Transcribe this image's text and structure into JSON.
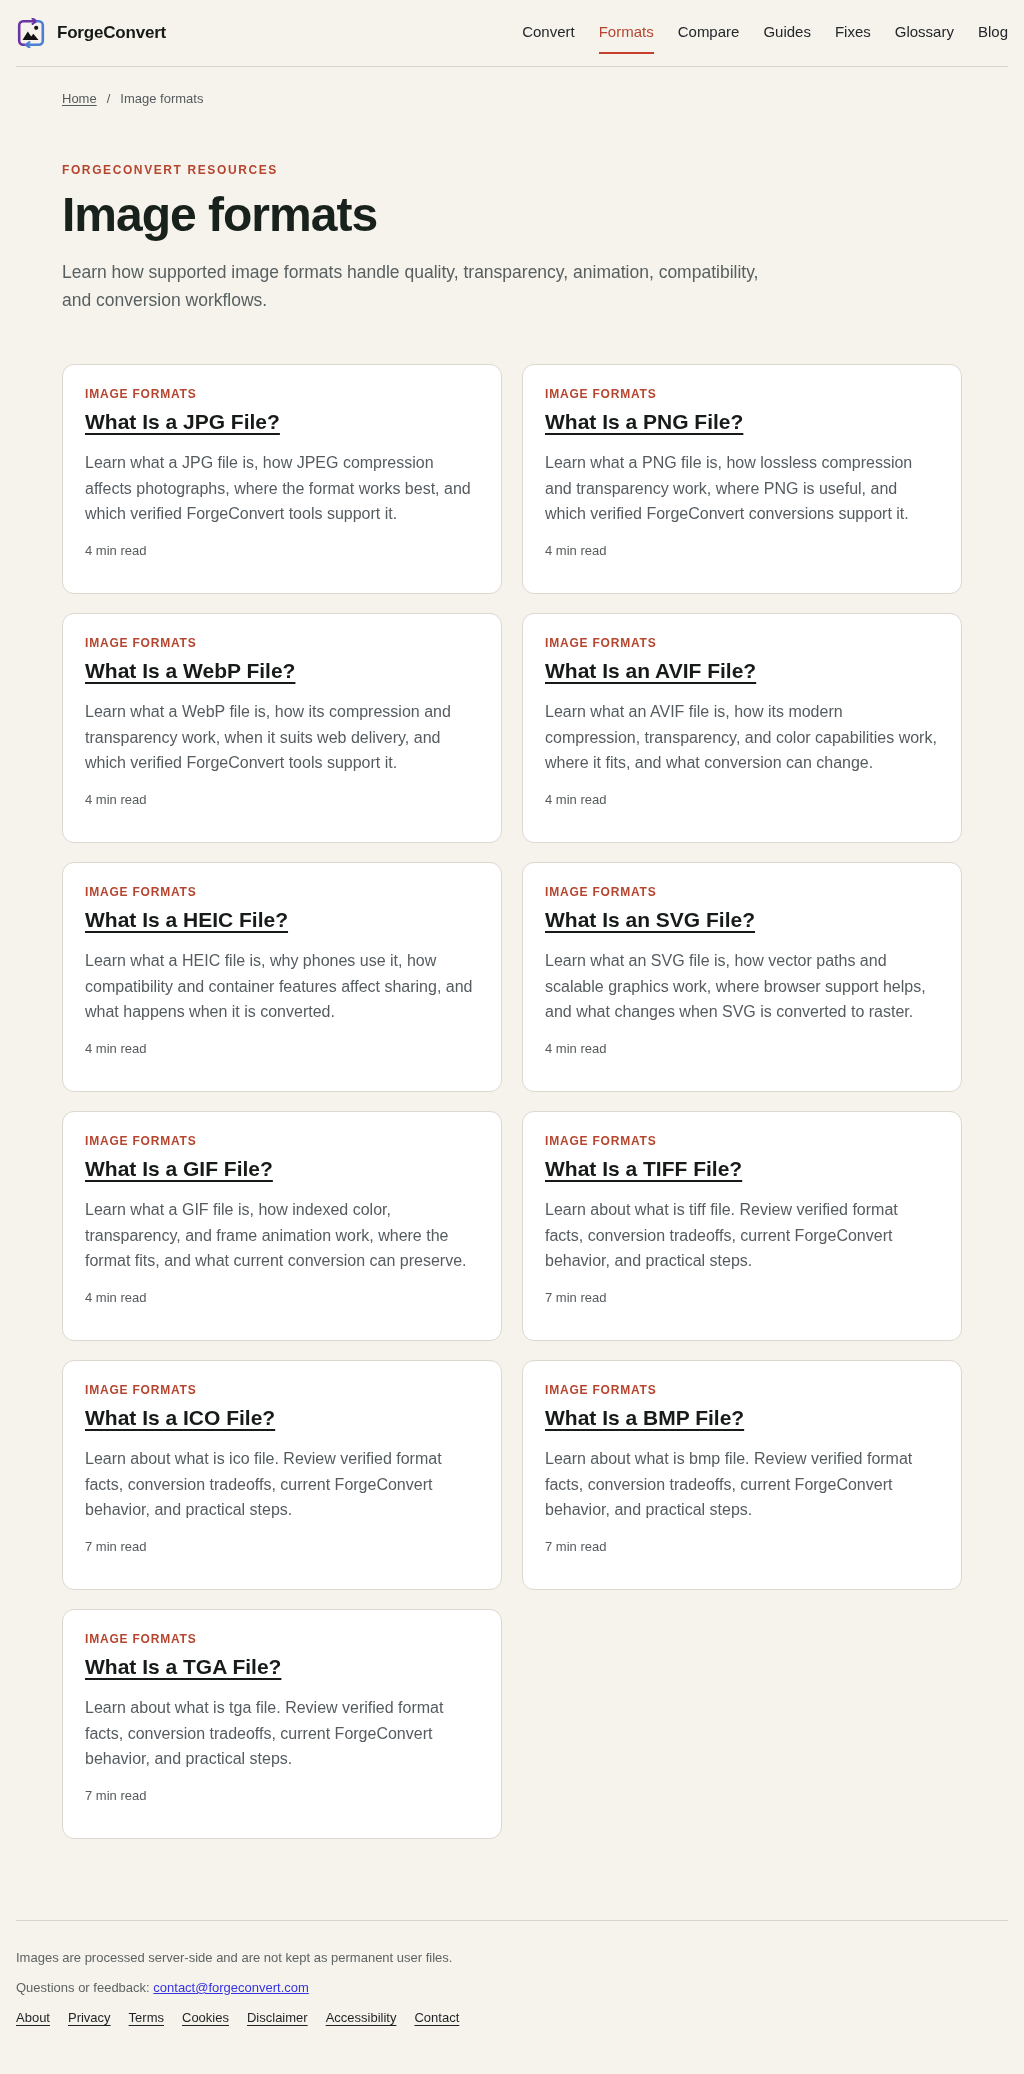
{
  "header": {
    "brand": "ForgeConvert",
    "nav": [
      {
        "label": "Convert",
        "selected": false
      },
      {
        "label": "Formats",
        "selected": true
      },
      {
        "label": "Compare",
        "selected": false
      },
      {
        "label": "Guides",
        "selected": false
      },
      {
        "label": "Fixes",
        "selected": false
      },
      {
        "label": "Glossary",
        "selected": false
      },
      {
        "label": "Blog",
        "selected": false
      }
    ]
  },
  "breadcrumb": {
    "home": "Home",
    "separator": "/",
    "current": "Image formats"
  },
  "hero": {
    "eyebrow": "FORGECONVERT RESOURCES",
    "title": "Image formats",
    "lead": "Learn how supported image formats handle quality, transparency, animation, compatibility, and conversion workflows."
  },
  "cards": [
    {
      "category": "IMAGE FORMATS",
      "title": "What Is a JPG File?",
      "description": "Learn what a JPG file is, how JPEG compression affects photographs, where the format works best, and which verified ForgeConvert tools support it.",
      "read_time": "4 min read"
    },
    {
      "category": "IMAGE FORMATS",
      "title": "What Is a PNG File?",
      "description": "Learn what a PNG file is, how lossless compression and transparency work, where PNG is useful, and which verified ForgeConvert conversions support it.",
      "read_time": "4 min read"
    },
    {
      "category": "IMAGE FORMATS",
      "title": "What Is a WebP File?",
      "description": "Learn what a WebP file is, how its compression and transparency work, when it suits web delivery, and which verified ForgeConvert tools support it.",
      "read_time": "4 min read"
    },
    {
      "category": "IMAGE FORMATS",
      "title": "What Is an AVIF File?",
      "description": "Learn what an AVIF file is, how its modern compression, transparency, and color capabilities work, where it fits, and what conversion can change.",
      "read_time": "4 min read"
    },
    {
      "category": "IMAGE FORMATS",
      "title": "What Is a HEIC File?",
      "description": "Learn what a HEIC file is, why phones use it, how compatibility and container features affect sharing, and what happens when it is converted.",
      "read_time": "4 min read"
    },
    {
      "category": "IMAGE FORMATS",
      "title": "What Is an SVG File?",
      "description": "Learn what an SVG file is, how vector paths and scalable graphics work, where browser support helps, and what changes when SVG is converted to raster.",
      "read_time": "4 min read"
    },
    {
      "category": "IMAGE FORMATS",
      "title": "What Is a GIF File?",
      "description": "Learn what a GIF file is, how indexed color, transparency, and frame animation work, where the format fits, and what current conversion can preserve.",
      "read_time": "4 min read"
    },
    {
      "category": "IMAGE FORMATS",
      "title": "What Is a TIFF File?",
      "description": "Learn about what is tiff file. Review verified format facts, conversion tradeoffs, current ForgeConvert behavior, and practical steps.",
      "read_time": "7 min read"
    },
    {
      "category": "IMAGE FORMATS",
      "title": "What Is a ICO File?",
      "description": "Learn about what is ico file. Review verified format facts, conversion tradeoffs, current ForgeConvert behavior, and practical steps.",
      "read_time": "7 min read"
    },
    {
      "category": "IMAGE FORMATS",
      "title": "What Is a BMP File?",
      "description": "Learn about what is bmp file. Review verified format facts, conversion tradeoffs, current ForgeConvert behavior, and practical steps.",
      "read_time": "7 min read"
    },
    {
      "category": "IMAGE FORMATS",
      "title": "What Is a TGA File?",
      "description": "Learn about what is tga file. Review verified format facts, conversion tradeoffs, current ForgeConvert behavior, and practical steps.",
      "read_time": "7 min read"
    }
  ],
  "footer": {
    "note": "Images are processed server-side and are not kept as permanent user files.",
    "contact_label": "Questions or feedback:",
    "contact_email": "contact@forgeconvert.com",
    "links": [
      "About",
      "Privacy",
      "Terms",
      "Cookies",
      "Disclaimer",
      "Accessibility",
      "Contact"
    ]
  }
}
